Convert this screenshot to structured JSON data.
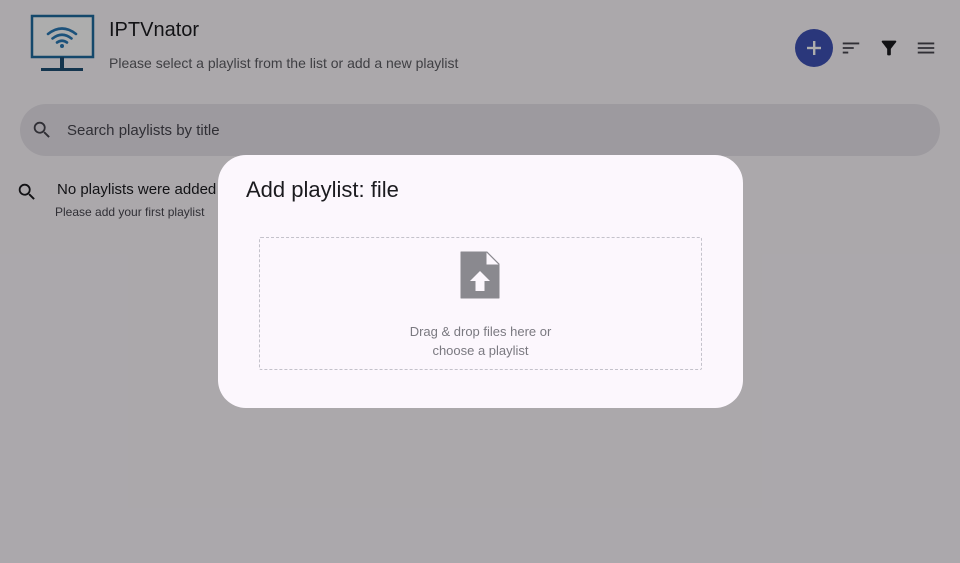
{
  "app": {
    "title": "IPTVnator",
    "subtitle": "Please select a playlist from the list or add a new playlist"
  },
  "toolbar": {
    "add_icon": "add-icon",
    "sort_icon": "sort-icon",
    "filter_icon": "filter-icon",
    "menu_icon": "menu-icon",
    "accent_color": "#3f51b5"
  },
  "search": {
    "placeholder": "Search playlists by title",
    "value": ""
  },
  "empty_state": {
    "title": "No playlists were added",
    "subtitle": "Please add your first playlist"
  },
  "dialog": {
    "title": "Add playlist: file",
    "dropzone_line1": "Drag & drop files here or",
    "dropzone_line2": "choose a playlist",
    "icon": "file-upload-icon"
  }
}
